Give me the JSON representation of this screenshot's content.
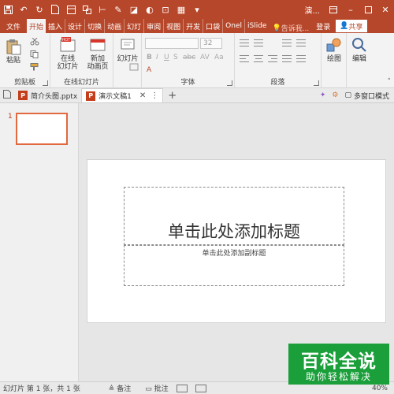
{
  "titlebar": {
    "title": "演...",
    "bg_color": "#b7472a"
  },
  "tabs": [
    {
      "label": "文件",
      "active": false
    },
    {
      "label": "开始",
      "active": true
    },
    {
      "label": "插入",
      "active": false
    },
    {
      "label": "设计",
      "active": false
    },
    {
      "label": "切换",
      "active": false
    },
    {
      "label": "动画",
      "active": false
    },
    {
      "label": "幻灯",
      "active": false
    },
    {
      "label": "审阅",
      "active": false
    },
    {
      "label": "视图",
      "active": false
    },
    {
      "label": "开发",
      "active": false
    },
    {
      "label": "口袋",
      "active": false
    },
    {
      "label": "Onel",
      "active": false
    },
    {
      "label": "iSlide",
      "active": false
    }
  ],
  "tell_me": "告诉我...",
  "login_label": "登录",
  "share_label": "共享",
  "ribbon": {
    "paste_label": "粘贴",
    "clipboard_group": "剪贴板",
    "online_slides_label": "在线\n幻灯片",
    "new_anim_page_label": "新加\n动画页",
    "online_slides_group": "在线幻灯片",
    "new_slide_label": "幻灯片",
    "font_group": "字体",
    "font_size": "32",
    "paragraph_group": "段落",
    "draw_label": "绘图",
    "edit_label": "编辑"
  },
  "doc_tabs": [
    {
      "label": "简介头图.pptx",
      "active": false
    },
    {
      "label": "演示文稿1",
      "active": true
    }
  ],
  "multi_window_label": "多窗口模式",
  "thumbnails": [
    {
      "number": "1"
    }
  ],
  "slide": {
    "title_placeholder": "单击此处添加标题",
    "subtitle_placeholder": "单击此处添加副标题"
  },
  "statusbar": {
    "slide_info": "幻灯片 第 1 张，共 1 张",
    "notes_label": "备注",
    "comments_label": "批注",
    "zoom": "40%"
  },
  "watermark": {
    "main": "百科全说",
    "sub": "助你轻松解决"
  }
}
